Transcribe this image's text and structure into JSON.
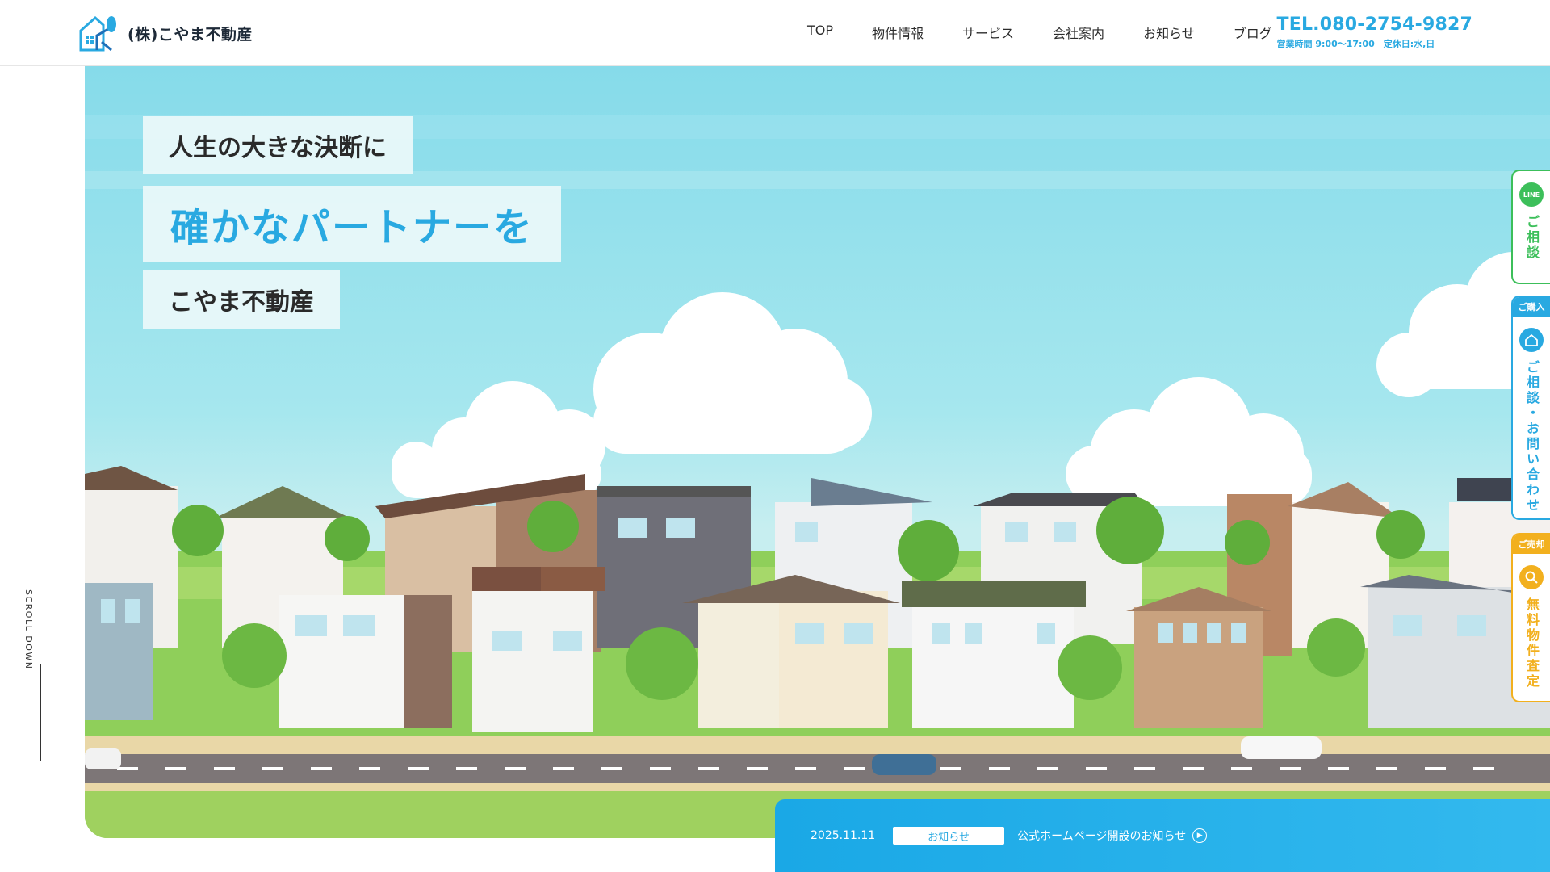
{
  "brand": {
    "company_name": "(株)こやま不動産",
    "accent_color": "#29a9e1"
  },
  "nav": {
    "items": [
      {
        "label": "TOP"
      },
      {
        "label": "物件情報"
      },
      {
        "label": "サービス"
      },
      {
        "label": "会社案内"
      },
      {
        "label": "お知らせ"
      },
      {
        "label": "ブログ"
      }
    ]
  },
  "contact": {
    "tel": "TEL.080-2754-9827",
    "hours": "営業時間 9:00〜17:00　定休日:水,日"
  },
  "hero": {
    "catch_line_1": "人生の大きな決断に",
    "catch_line_2": "確かなパートナーを",
    "catch_line_3": "こやま不動産"
  },
  "scroll": {
    "label": "SCROLL DOWN"
  },
  "news": {
    "date": "2025.11.11",
    "category": "お知らせ",
    "title": "公式ホームページ開設のお知らせ"
  },
  "side_tabs": {
    "line": {
      "icon_text": "LINE",
      "label": "ご相談",
      "color": "#3cbf5a"
    },
    "buy": {
      "head": "ご購入",
      "label": "ご相談・お問い合わせ",
      "color": "#29a9e1"
    },
    "sell": {
      "head": "ご売却",
      "label": "無料物件査定",
      "color": "#f2b01e"
    }
  }
}
